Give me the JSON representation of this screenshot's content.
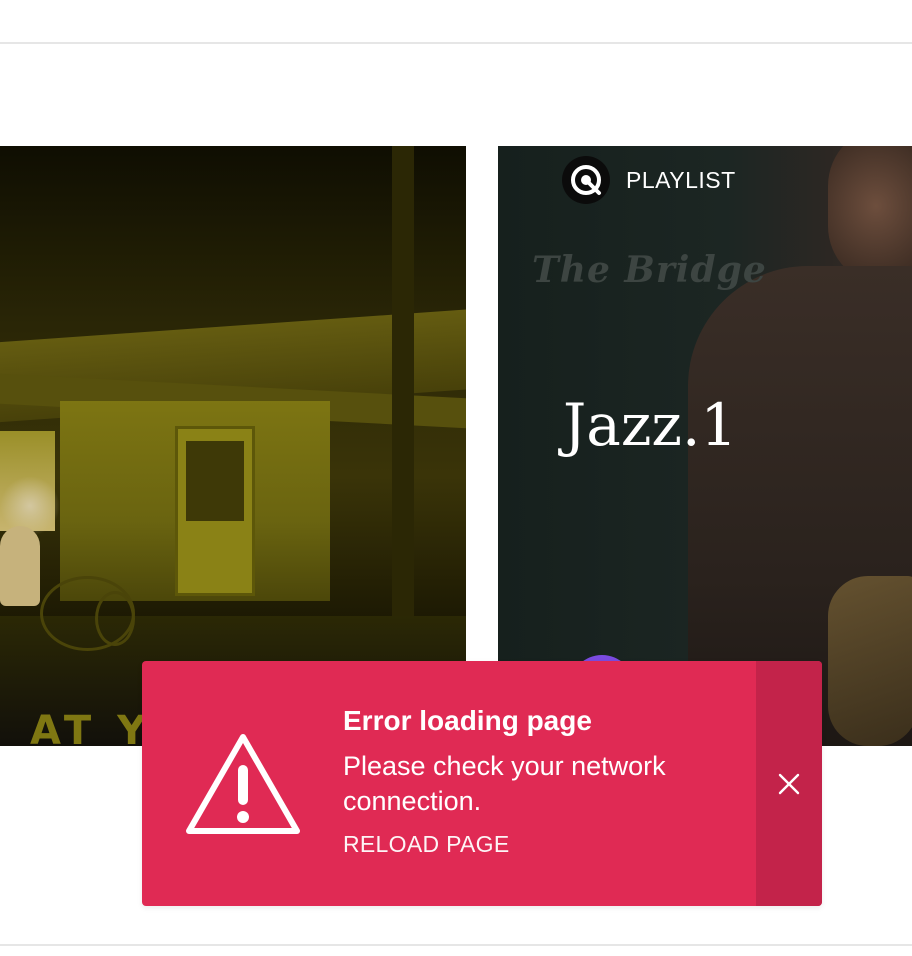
{
  "cards": [
    {
      "name": "left-card",
      "bottom_text": "AT Y"
    },
    {
      "name": "jazz-playlist-card",
      "badge_label": "PLAYLIST",
      "cover_text": "The Bridge",
      "title": "Jazz.1"
    }
  ],
  "toast": {
    "title": "Error loading page",
    "message": "Please check your network connection.",
    "action_label": "RELOAD PAGE",
    "icon": "warning-icon",
    "close_icon": "close-icon"
  },
  "colors": {
    "toast_background": "#e02a54",
    "toast_close_background": "#c3234a",
    "divider": "#e6e6e6",
    "avatar_accent": "#7b4be0"
  }
}
